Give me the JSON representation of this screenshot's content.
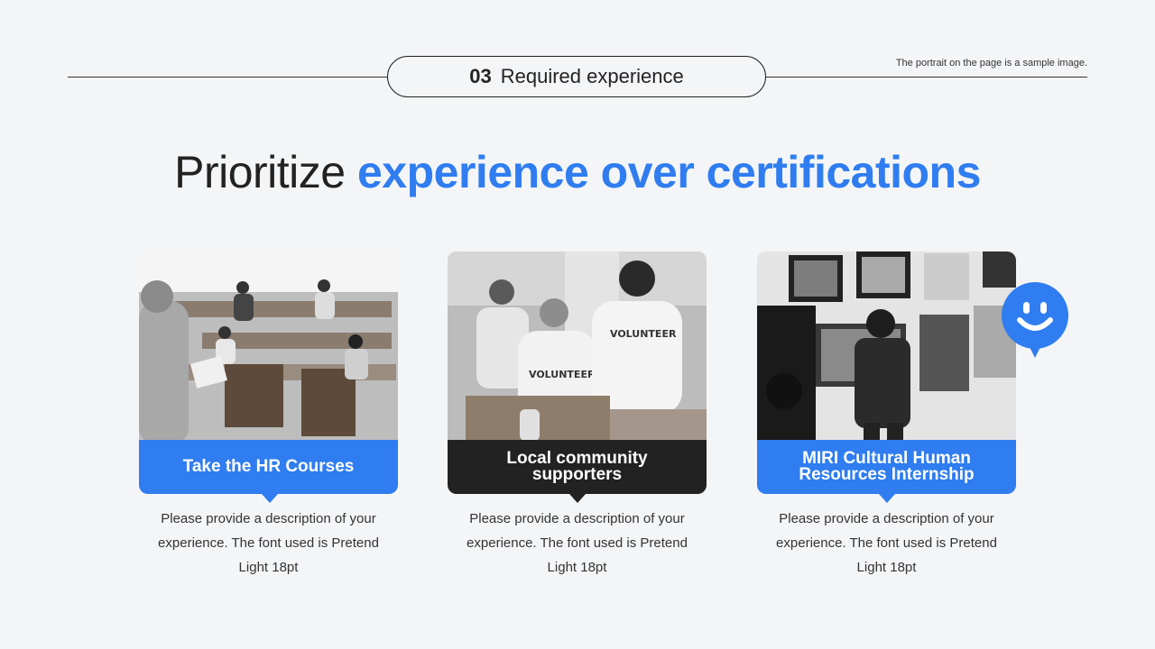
{
  "header": {
    "section_number": "03",
    "section_title": "Required experience",
    "sample_note": "The portrait on the page is a sample image."
  },
  "headline": {
    "light": "Prioritize",
    "highlight": "experience over certifications"
  },
  "cards": [
    {
      "title": "Take the HR Courses",
      "description": "Please provide a description of your experience. The font used is Pretend Light 18pt",
      "style": "blue"
    },
    {
      "title": "Local community supporters",
      "description": "Please provide a description of your experience. The font used is Pretend Light 18pt",
      "style": "dark"
    },
    {
      "title": "MIRI Cultural Human Resources Internship",
      "description": "Please provide a description of your experience. The font used is Pretend Light 18pt",
      "style": "blue"
    }
  ],
  "photos": {
    "volunteer_shirt_text": "VOLUNTEER"
  },
  "colors": {
    "accent": "#2f7df0",
    "dark": "#222222",
    "background": "#f4f5f7"
  },
  "icons": {
    "smiley": "smiley-chat-bubble-icon"
  }
}
